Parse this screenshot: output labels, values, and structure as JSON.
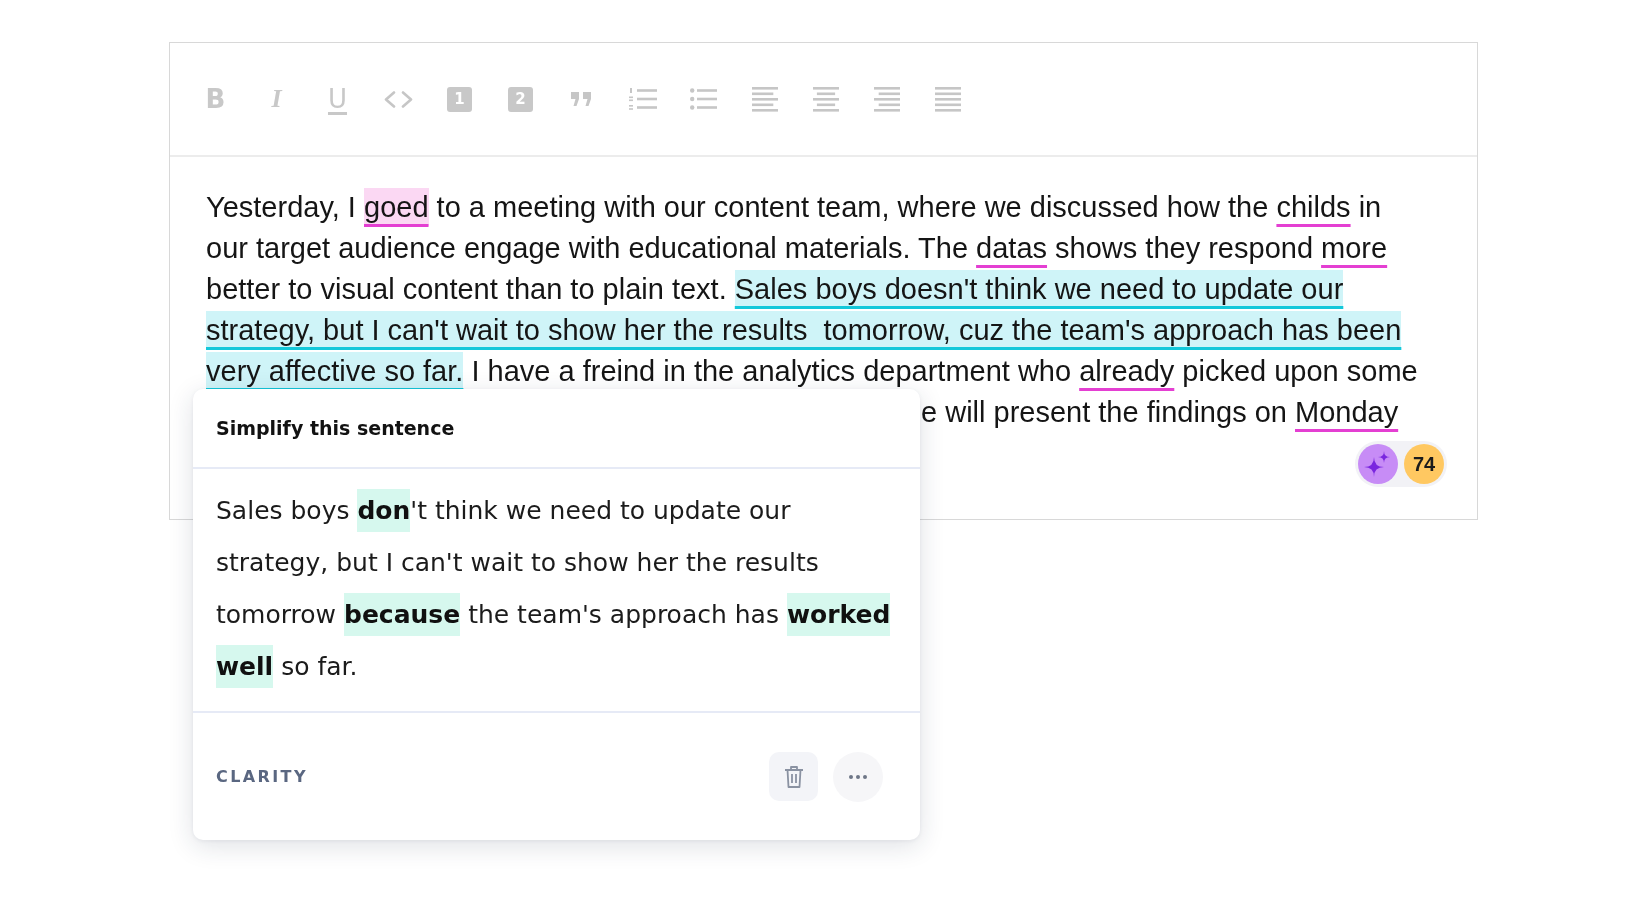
{
  "toolbar": [
    {
      "kind": "bold",
      "label": "B"
    },
    {
      "kind": "italic",
      "label": "I"
    },
    {
      "kind": "underline",
      "label": "U"
    },
    {
      "kind": "code"
    },
    {
      "kind": "heading",
      "label": "1"
    },
    {
      "kind": "heading",
      "label": "2"
    },
    {
      "kind": "quote"
    },
    {
      "kind": "numbered"
    },
    {
      "kind": "bulleted"
    },
    {
      "kind": "left"
    },
    {
      "kind": "center"
    },
    {
      "kind": "right"
    },
    {
      "kind": "justify"
    }
  ],
  "editor": {
    "lines": [
      {
        "segments": [
          {
            "text": "Yesterday, I ",
            "kind": "plain"
          },
          {
            "text": "goed",
            "kind": "correctness",
            "selected": true
          },
          {
            "text": " to a meeting with our content team, where we discussed how the ",
            "kind": "plain"
          },
          {
            "text": "childs",
            "kind": "correctness",
            "selected": false
          },
          {
            "text": " in",
            "kind": "plain"
          }
        ]
      },
      {
        "segments": [
          {
            "text": "our target audience engage with educational materials. The ",
            "kind": "plain"
          },
          {
            "text": "datas",
            "kind": "correctness",
            "selected": false
          },
          {
            "text": " shows they respond ",
            "kind": "plain"
          },
          {
            "text": "more",
            "kind": "correctness",
            "selected": false
          }
        ]
      },
      {
        "segments": [
          {
            "text": "better to visual content than to plain text. ",
            "kind": "plain"
          },
          {
            "text": "Sales boys doesn't think we need to update our",
            "kind": "clarity",
            "selected": true
          }
        ]
      },
      {
        "segments": [
          {
            "text": "strategy, but I can't wait to show her the results  tomorrow, cuz the team's approach has been",
            "kind": "clarity",
            "selected": true
          }
        ]
      },
      {
        "segments": [
          {
            "text": "very affective so far.",
            "kind": "clarity",
            "selected": true
          },
          {
            "text": " I have a freind in the analytics department who ",
            "kind": "plain"
          },
          {
            "text": "already",
            "kind": "correctness",
            "selected": false
          },
          {
            "text": " picked upon some",
            "kind": "plain"
          }
        ]
      }
    ],
    "visible_line_end": {
      "segments": [
        {
          "text": "e will present the findings on ",
          "kind": "plain"
        },
        {
          "text": "Monday",
          "kind": "correctness",
          "selected": false
        }
      ]
    }
  },
  "score_widget": {
    "score": "74"
  },
  "suggestion_card": {
    "title": "Simplify this sentence",
    "lines": [
      {
        "segments": [
          {
            "text": "Sales boys ",
            "kind": "plain"
          },
          {
            "text": "don",
            "kind": "inserted"
          },
          {
            "text": "'t think we need to update our",
            "kind": "plain"
          }
        ]
      },
      {
        "segments": [
          {
            "text": "strategy, but I can't wait to show her the results",
            "kind": "plain"
          }
        ]
      },
      {
        "segments": [
          {
            "text": "tomorrow ",
            "kind": "plain"
          },
          {
            "text": "because",
            "kind": "inserted"
          },
          {
            "text": " the team's approach has ",
            "kind": "plain"
          },
          {
            "text": "worked",
            "kind": "inserted"
          }
        ]
      },
      {
        "segments": [
          {
            "text": "well",
            "kind": "inserted"
          },
          {
            "text": " so far.",
            "kind": "plain"
          }
        ]
      }
    ],
    "category": "CLARITY"
  }
}
